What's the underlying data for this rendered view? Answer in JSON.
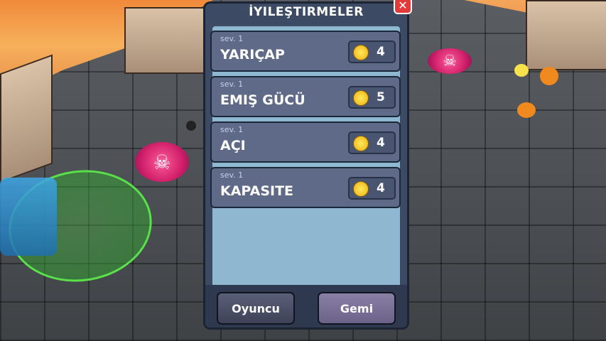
{
  "dialog": {
    "title": "İYILEŞTIRMELER",
    "close_icon": "close-icon",
    "items": [
      {
        "level": "sev. 1",
        "name": "YARIÇAP",
        "cost": "4"
      },
      {
        "level": "sev. 1",
        "name": "EMIŞ GÜCÜ",
        "cost": "5"
      },
      {
        "level": "sev. 1",
        "name": "AÇI",
        "cost": "4"
      },
      {
        "level": "sev. 1",
        "name": "KAPASITE",
        "cost": "4"
      }
    ],
    "buttons": {
      "player": "Oyuncu",
      "ship": "Gemi"
    }
  },
  "colors": {
    "accent": "#e23a3a",
    "coin": "#f3c022",
    "zone": "#5ae04a",
    "skull": "#d0206a"
  }
}
